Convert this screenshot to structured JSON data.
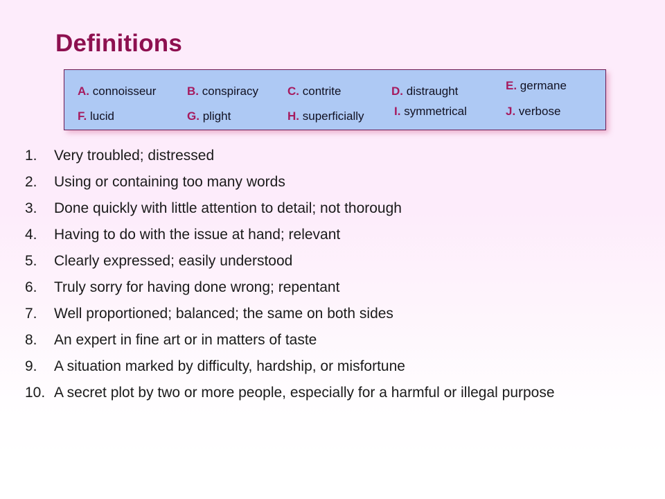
{
  "slide": {
    "title": "Definitions",
    "background_top_color": "#fdecfb",
    "background_bottom_color": "#ffffff",
    "title_color": "#8d1050"
  },
  "word_bank": {
    "fill_color": "#aec9f4",
    "border_color": "#6d1a53",
    "letter_color": "#a61a5e",
    "word_color": "#111122",
    "entries": [
      {
        "letter": "A.",
        "word": "connoisseur"
      },
      {
        "letter": "B.",
        "word": "conspiracy"
      },
      {
        "letter": "C.",
        "word": "contrite"
      },
      {
        "letter": "D.",
        "word": "distraught"
      },
      {
        "letter": "E.",
        "word": "germane"
      },
      {
        "letter": "F.",
        "word": "lucid"
      },
      {
        "letter": "G.",
        "word": "plight"
      },
      {
        "letter": "H.",
        "word": "superficially"
      },
      {
        "letter": "I.",
        "word": "symmetrical"
      },
      {
        "letter": "J.",
        "word": "verbose"
      }
    ]
  },
  "definitions": {
    "items": [
      {
        "number": "1.",
        "text": "Very troubled; distressed"
      },
      {
        "number": "2.",
        "text": "Using or containing too many words"
      },
      {
        "number": "3.",
        "text": "Done quickly with little attention to detail; not thorough"
      },
      {
        "number": "4.",
        "text": "Having to do with the issue at hand; relevant"
      },
      {
        "number": "5.",
        "text": "Clearly expressed; easily understood"
      },
      {
        "number": "6.",
        "text": "Truly sorry for having done wrong; repentant"
      },
      {
        "number": "7.",
        "text": "Well proportioned; balanced; the same on both sides"
      },
      {
        "number": "8.",
        "text": "An expert in fine art or in matters of taste"
      },
      {
        "number": "9.",
        "text": "A situation marked by difficulty, hardship, or misfortune"
      },
      {
        "number": "10.",
        "text": "A secret plot by two or more people, especially for a harmful or illegal purpose"
      }
    ]
  }
}
